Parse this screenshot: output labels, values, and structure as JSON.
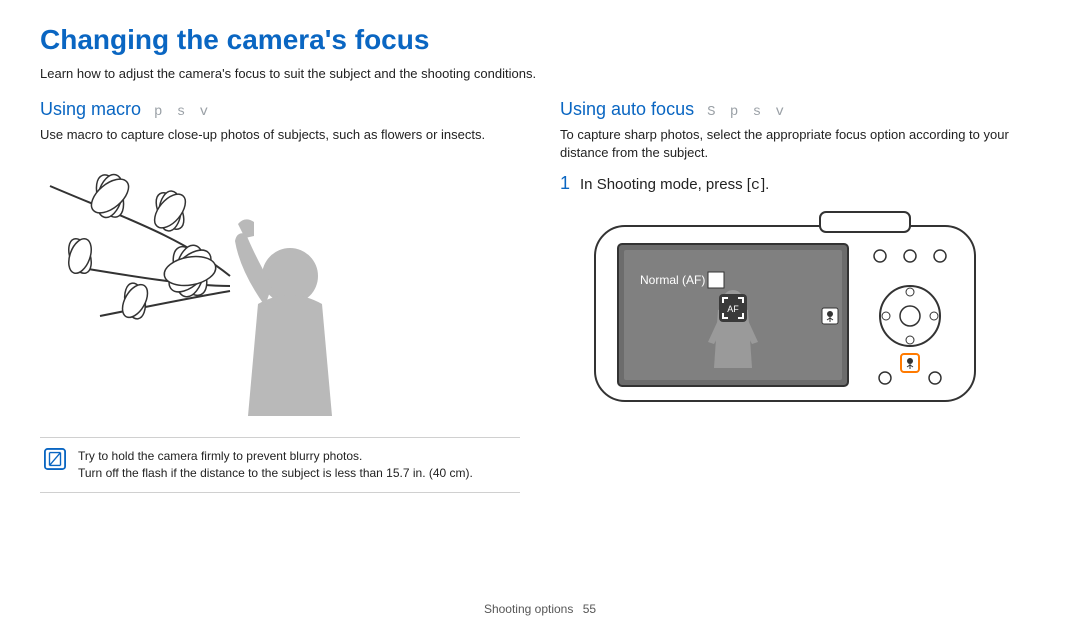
{
  "page": {
    "title": "Changing the camera's focus",
    "intro": "Learn how to adjust the camera's focus to suit the subject and the shooting conditions."
  },
  "left": {
    "heading": "Using macro",
    "modes": "p s v",
    "body": "Use macro to capture close-up photos of subjects, such as flowers or insects.",
    "note": {
      "line1": "Try to hold the camera firmly to prevent blurry photos.",
      "line2": "Turn off the flash if the distance to the subject is less than 15.7 in. (40 cm)."
    }
  },
  "right": {
    "heading": "Using auto focus",
    "modes": "S p s v",
    "body": "To capture sharp photos, select the appropriate focus option according to your distance from the subject.",
    "step_number": "1",
    "step_text_prefix": "In Shooting mode, press [",
    "step_key": "c",
    "step_text_suffix": "].",
    "lcd_label": "Normal (AF)",
    "lcd_icon_glyph": "AF"
  },
  "footer": {
    "section": "Shooting options",
    "page": "55"
  }
}
